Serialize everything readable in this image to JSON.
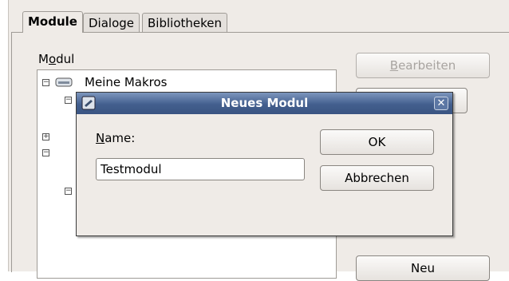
{
  "tabs": [
    {
      "label": "Module",
      "active": true
    },
    {
      "label": "Dialoge",
      "active": false
    },
    {
      "label": "Bibliotheken",
      "active": false
    }
  ],
  "module_section": {
    "label_pre": "M",
    "label_mnemonic": "o",
    "label_post": "dul",
    "tree_items": [
      {
        "label": "Meine Makros",
        "expanded": true
      }
    ]
  },
  "side_buttons": {
    "edit_mnemonic": "B",
    "edit_rest": "earbeiten",
    "new_label": "Neu"
  },
  "dialog": {
    "title": "Neues Modul",
    "close_symbol": "✕",
    "name_mnemonic": "N",
    "name_rest": "ame:",
    "name_value": "Testmodul",
    "ok_label": "OK",
    "cancel_label": "Abbrechen"
  },
  "colors": {
    "window_bg": "#efebe7",
    "titlebar": "#435f8e",
    "disabled_text": "#a8a4a0"
  },
  "icons": [
    "folder-icon",
    "document-icon",
    "close-icon",
    "collapse-icon",
    "expand-icon"
  ]
}
